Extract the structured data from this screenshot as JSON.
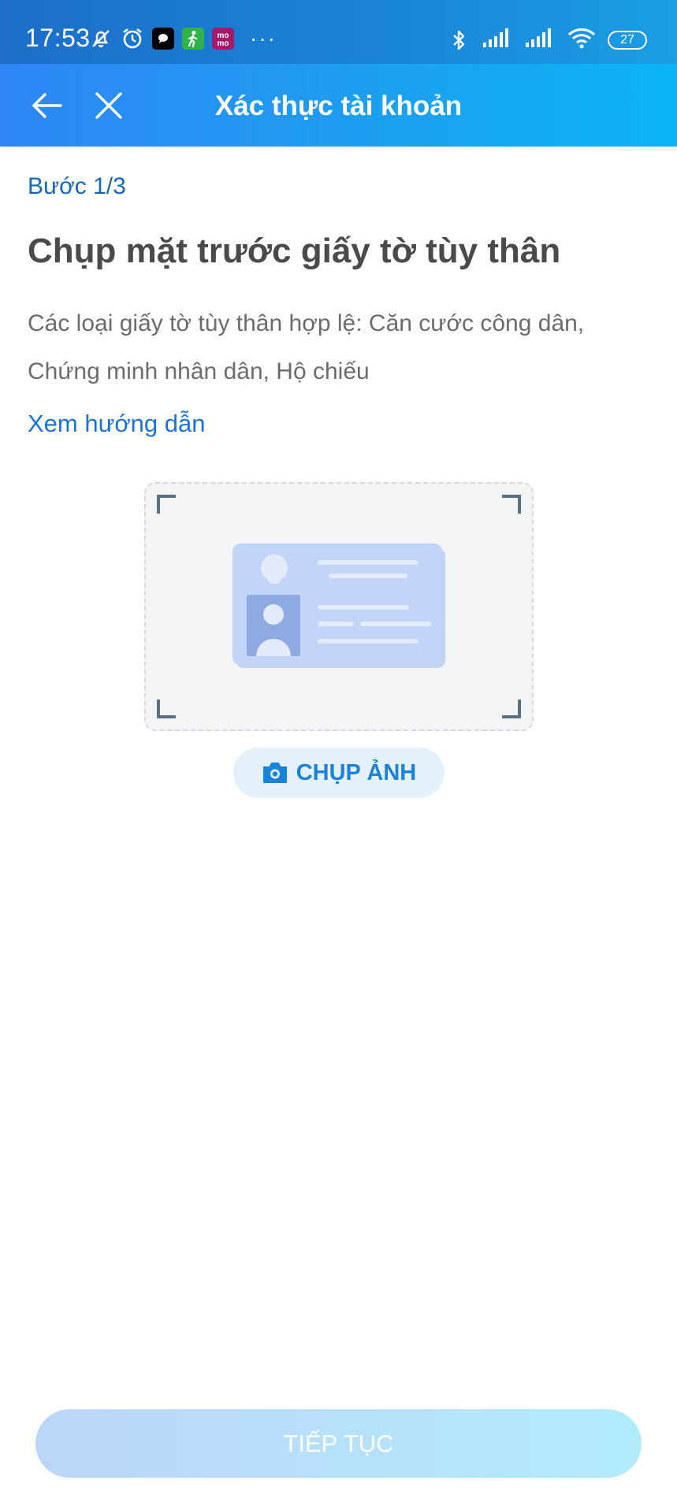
{
  "status_bar": {
    "time": "17:53",
    "battery": "27",
    "left_icons": [
      "mute-icon",
      "alarm-icon",
      "message-app-icon",
      "fitness-app-icon",
      "momo-app-icon"
    ],
    "momo_badge_text": "mo\nmo",
    "more_indicator": "···",
    "right_icons": [
      "bluetooth-icon",
      "signal-icon",
      "signal-icon",
      "wifi-icon",
      "battery-icon"
    ]
  },
  "header": {
    "title": "Xác thực tài khoản",
    "back_icon": "arrow-left-icon",
    "close_icon": "close-icon"
  },
  "content": {
    "step": "Bước 1/3",
    "title": "Chụp mặt trước giấy tờ tùy thân",
    "description": "Các loại giấy tờ tùy thân hợp lệ: Căn cước công dân, Chứng minh nhân dân, Hộ chiếu",
    "guide_link": "Xem hướng dẫn",
    "illustration_icon": "id-card-icon",
    "capture_button": {
      "label": "CHỤP ẢNH",
      "icon": "camera-icon"
    }
  },
  "footer": {
    "continue_label": "TIẾP TỤC"
  },
  "colors": {
    "header_gradient_start": "#2f86f6",
    "header_gradient_end": "#0ab4f4",
    "step_color": "#1567b8",
    "link_color": "#1a73d6",
    "capture_text": "#1a82d8",
    "continue_bg_start": "#bcd6fa",
    "continue_bg_end": "#b2ecfb"
  }
}
